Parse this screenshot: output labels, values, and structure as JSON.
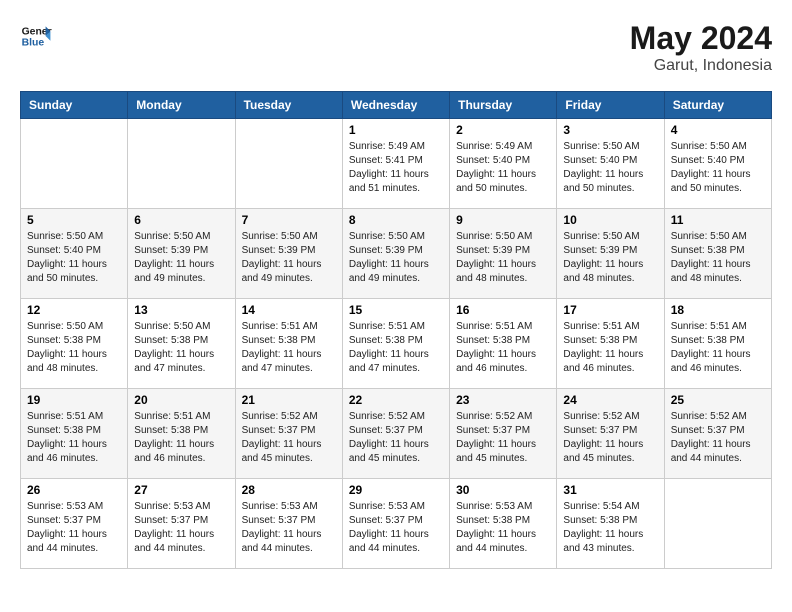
{
  "header": {
    "logo_text_general": "General",
    "logo_text_blue": "Blue",
    "month_year": "May 2024",
    "location": "Garut, Indonesia"
  },
  "weekdays": [
    "Sunday",
    "Monday",
    "Tuesday",
    "Wednesday",
    "Thursday",
    "Friday",
    "Saturday"
  ],
  "weeks": [
    [
      {
        "day": "",
        "sunrise": "",
        "sunset": "",
        "daylight": ""
      },
      {
        "day": "",
        "sunrise": "",
        "sunset": "",
        "daylight": ""
      },
      {
        "day": "",
        "sunrise": "",
        "sunset": "",
        "daylight": ""
      },
      {
        "day": "1",
        "sunrise": "Sunrise: 5:49 AM",
        "sunset": "Sunset: 5:41 PM",
        "daylight": "Daylight: 11 hours and 51 minutes."
      },
      {
        "day": "2",
        "sunrise": "Sunrise: 5:49 AM",
        "sunset": "Sunset: 5:40 PM",
        "daylight": "Daylight: 11 hours and 50 minutes."
      },
      {
        "day": "3",
        "sunrise": "Sunrise: 5:50 AM",
        "sunset": "Sunset: 5:40 PM",
        "daylight": "Daylight: 11 hours and 50 minutes."
      },
      {
        "day": "4",
        "sunrise": "Sunrise: 5:50 AM",
        "sunset": "Sunset: 5:40 PM",
        "daylight": "Daylight: 11 hours and 50 minutes."
      }
    ],
    [
      {
        "day": "5",
        "sunrise": "Sunrise: 5:50 AM",
        "sunset": "Sunset: 5:40 PM",
        "daylight": "Daylight: 11 hours and 50 minutes."
      },
      {
        "day": "6",
        "sunrise": "Sunrise: 5:50 AM",
        "sunset": "Sunset: 5:39 PM",
        "daylight": "Daylight: 11 hours and 49 minutes."
      },
      {
        "day": "7",
        "sunrise": "Sunrise: 5:50 AM",
        "sunset": "Sunset: 5:39 PM",
        "daylight": "Daylight: 11 hours and 49 minutes."
      },
      {
        "day": "8",
        "sunrise": "Sunrise: 5:50 AM",
        "sunset": "Sunset: 5:39 PM",
        "daylight": "Daylight: 11 hours and 49 minutes."
      },
      {
        "day": "9",
        "sunrise": "Sunrise: 5:50 AM",
        "sunset": "Sunset: 5:39 PM",
        "daylight": "Daylight: 11 hours and 48 minutes."
      },
      {
        "day": "10",
        "sunrise": "Sunrise: 5:50 AM",
        "sunset": "Sunset: 5:39 PM",
        "daylight": "Daylight: 11 hours and 48 minutes."
      },
      {
        "day": "11",
        "sunrise": "Sunrise: 5:50 AM",
        "sunset": "Sunset: 5:38 PM",
        "daylight": "Daylight: 11 hours and 48 minutes."
      }
    ],
    [
      {
        "day": "12",
        "sunrise": "Sunrise: 5:50 AM",
        "sunset": "Sunset: 5:38 PM",
        "daylight": "Daylight: 11 hours and 48 minutes."
      },
      {
        "day": "13",
        "sunrise": "Sunrise: 5:50 AM",
        "sunset": "Sunset: 5:38 PM",
        "daylight": "Daylight: 11 hours and 47 minutes."
      },
      {
        "day": "14",
        "sunrise": "Sunrise: 5:51 AM",
        "sunset": "Sunset: 5:38 PM",
        "daylight": "Daylight: 11 hours and 47 minutes."
      },
      {
        "day": "15",
        "sunrise": "Sunrise: 5:51 AM",
        "sunset": "Sunset: 5:38 PM",
        "daylight": "Daylight: 11 hours and 47 minutes."
      },
      {
        "day": "16",
        "sunrise": "Sunrise: 5:51 AM",
        "sunset": "Sunset: 5:38 PM",
        "daylight": "Daylight: 11 hours and 46 minutes."
      },
      {
        "day": "17",
        "sunrise": "Sunrise: 5:51 AM",
        "sunset": "Sunset: 5:38 PM",
        "daylight": "Daylight: 11 hours and 46 minutes."
      },
      {
        "day": "18",
        "sunrise": "Sunrise: 5:51 AM",
        "sunset": "Sunset: 5:38 PM",
        "daylight": "Daylight: 11 hours and 46 minutes."
      }
    ],
    [
      {
        "day": "19",
        "sunrise": "Sunrise: 5:51 AM",
        "sunset": "Sunset: 5:38 PM",
        "daylight": "Daylight: 11 hours and 46 minutes."
      },
      {
        "day": "20",
        "sunrise": "Sunrise: 5:51 AM",
        "sunset": "Sunset: 5:38 PM",
        "daylight": "Daylight: 11 hours and 46 minutes."
      },
      {
        "day": "21",
        "sunrise": "Sunrise: 5:52 AM",
        "sunset": "Sunset: 5:37 PM",
        "daylight": "Daylight: 11 hours and 45 minutes."
      },
      {
        "day": "22",
        "sunrise": "Sunrise: 5:52 AM",
        "sunset": "Sunset: 5:37 PM",
        "daylight": "Daylight: 11 hours and 45 minutes."
      },
      {
        "day": "23",
        "sunrise": "Sunrise: 5:52 AM",
        "sunset": "Sunset: 5:37 PM",
        "daylight": "Daylight: 11 hours and 45 minutes."
      },
      {
        "day": "24",
        "sunrise": "Sunrise: 5:52 AM",
        "sunset": "Sunset: 5:37 PM",
        "daylight": "Daylight: 11 hours and 45 minutes."
      },
      {
        "day": "25",
        "sunrise": "Sunrise: 5:52 AM",
        "sunset": "Sunset: 5:37 PM",
        "daylight": "Daylight: 11 hours and 44 minutes."
      }
    ],
    [
      {
        "day": "26",
        "sunrise": "Sunrise: 5:53 AM",
        "sunset": "Sunset: 5:37 PM",
        "daylight": "Daylight: 11 hours and 44 minutes."
      },
      {
        "day": "27",
        "sunrise": "Sunrise: 5:53 AM",
        "sunset": "Sunset: 5:37 PM",
        "daylight": "Daylight: 11 hours and 44 minutes."
      },
      {
        "day": "28",
        "sunrise": "Sunrise: 5:53 AM",
        "sunset": "Sunset: 5:37 PM",
        "daylight": "Daylight: 11 hours and 44 minutes."
      },
      {
        "day": "29",
        "sunrise": "Sunrise: 5:53 AM",
        "sunset": "Sunset: 5:37 PM",
        "daylight": "Daylight: 11 hours and 44 minutes."
      },
      {
        "day": "30",
        "sunrise": "Sunrise: 5:53 AM",
        "sunset": "Sunset: 5:38 PM",
        "daylight": "Daylight: 11 hours and 44 minutes."
      },
      {
        "day": "31",
        "sunrise": "Sunrise: 5:54 AM",
        "sunset": "Sunset: 5:38 PM",
        "daylight": "Daylight: 11 hours and 43 minutes."
      },
      {
        "day": "",
        "sunrise": "",
        "sunset": "",
        "daylight": ""
      }
    ]
  ]
}
